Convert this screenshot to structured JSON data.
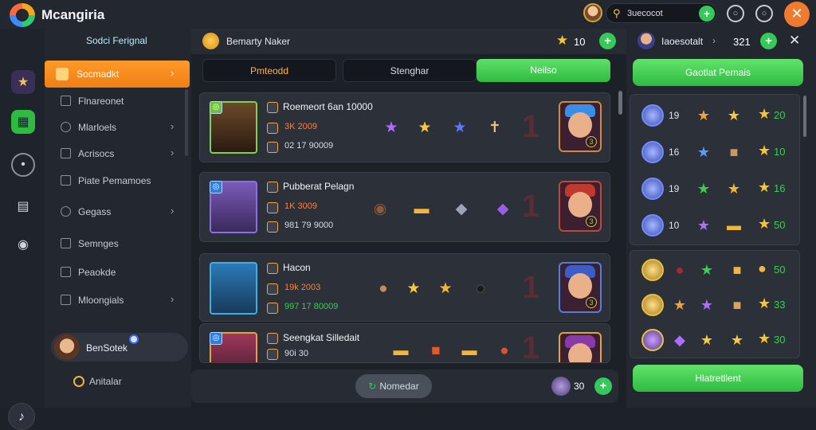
{
  "app": {
    "title": "Mcangiria"
  },
  "top": {
    "search_value": "3uecocot"
  },
  "sidebar": {
    "title": "Sodci Ferignal",
    "active_item": "Socmadkt",
    "items": [
      {
        "label": "Flnareonet"
      },
      {
        "label": "Mlarloels"
      },
      {
        "label": "Acrisocs"
      },
      {
        "label": "Piate Pemamoes"
      },
      {
        "label": "Gegass"
      },
      {
        "label": "Semnges"
      },
      {
        "label": "Peaokde"
      },
      {
        "label": "Mloongials"
      }
    ],
    "user_name": "BenSotek",
    "footer_label": "Anitalar"
  },
  "main": {
    "header_label": "Bemarty Naker",
    "header_count": "10",
    "tabs": [
      {
        "label": "Pmteodd"
      },
      {
        "label": "Stenghar"
      },
      {
        "label": "Neilso"
      }
    ],
    "cards": [
      {
        "name": "Roemeort 6an 10000",
        "stat1": "3K 2009",
        "stat2": "02 17 90009"
      },
      {
        "name": "Pubberat Pelagn",
        "stat1": "1K 3009",
        "stat2": "981 79 9000"
      },
      {
        "name": "Hacon",
        "stat1": "19k 2003",
        "stat2": "997 17 80009"
      },
      {
        "name": "Seengkat Silledait",
        "stat1": "",
        "stat2": "90i 30"
      }
    ],
    "footer_label": "Nomedar",
    "footer_count": "30"
  },
  "right": {
    "user_name": "Iaoesotalt",
    "count": "321",
    "top_button": "Gaotlat Pemais",
    "bottom_button": "Hlatretllent",
    "rows": [
      {
        "num": "19",
        "score": "20"
      },
      {
        "num": "16",
        "score": "10"
      },
      {
        "num": "19",
        "score": "16"
      },
      {
        "num": "10",
        "score": "50"
      },
      {
        "num": "",
        "score": "50"
      },
      {
        "num": "",
        "score": "33"
      },
      {
        "num": "",
        "score": "30"
      }
    ]
  }
}
